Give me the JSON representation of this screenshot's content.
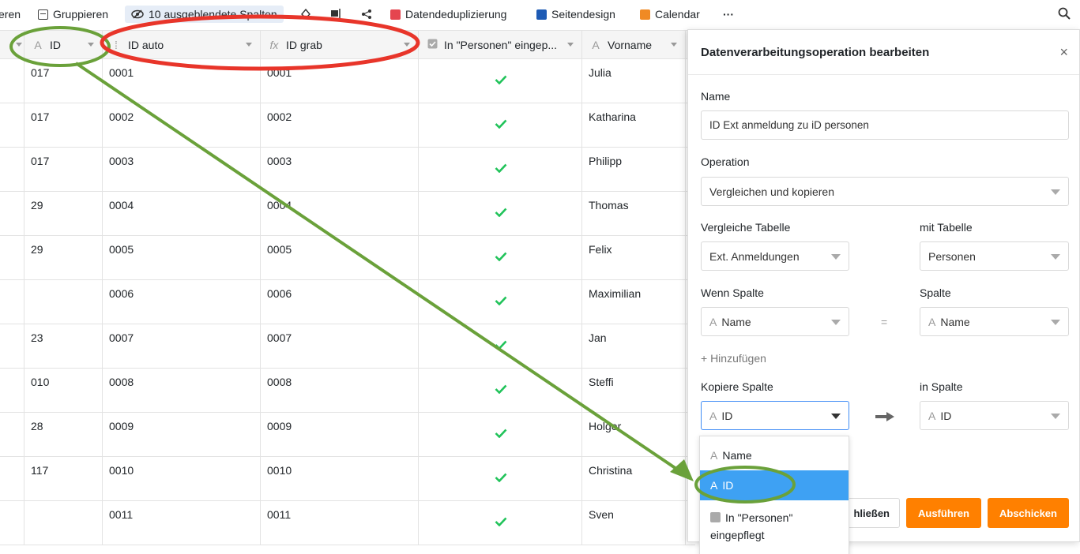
{
  "toolbar": {
    "partial_left": "eren",
    "group": "Gruppieren",
    "hidden_columns": "10 ausgeblendete Spalten",
    "dedup": "Datendeduplizierung",
    "page_design": "Seitendesign",
    "calendar": "Calendar",
    "more": "···",
    "colors": {
      "dedup": "#e5454f",
      "page_design": "#1e5bb5",
      "calendar": "#f08a24"
    }
  },
  "table": {
    "columns": [
      {
        "label": "ID",
        "icon": "text-icon"
      },
      {
        "label": "ID auto",
        "icon": "autonumber-icon"
      },
      {
        "label": "ID grab",
        "icon": "formula-icon"
      },
      {
        "label": "In \"Personen\" eingep...",
        "icon": "checkbox-icon"
      },
      {
        "label": "Vorname",
        "icon": "text-icon"
      }
    ],
    "rows": [
      {
        "id": "017",
        "auto": "0001",
        "grab": "0001",
        "checked": true,
        "vorname": "Julia"
      },
      {
        "id": "017",
        "auto": "0002",
        "grab": "0002",
        "checked": true,
        "vorname": "Katharina"
      },
      {
        "id": "017",
        "auto": "0003",
        "grab": "0003",
        "checked": true,
        "vorname": "Philipp"
      },
      {
        "id": "29",
        "auto": "0004",
        "grab": "0004",
        "checked": true,
        "vorname": "Thomas"
      },
      {
        "id": "29",
        "auto": "0005",
        "grab": "0005",
        "checked": true,
        "vorname": "Felix"
      },
      {
        "id": "",
        "auto": "0006",
        "grab": "0006",
        "checked": true,
        "vorname": "Maximilian"
      },
      {
        "id": "23",
        "auto": "0007",
        "grab": "0007",
        "checked": true,
        "vorname": "Jan"
      },
      {
        "id": "010",
        "auto": "0008",
        "grab": "0008",
        "checked": true,
        "vorname": "Steffi"
      },
      {
        "id": "28",
        "auto": "0009",
        "grab": "0009",
        "checked": true,
        "vorname": "Holger"
      },
      {
        "id": "117",
        "auto": "0010",
        "grab": "0010",
        "checked": true,
        "vorname": "Christina"
      },
      {
        "id": "",
        "auto": "0011",
        "grab": "0011",
        "checked": true,
        "vorname": "Sven"
      }
    ],
    "check_color": "#21c35a"
  },
  "panel": {
    "title": "Datenverarbeitungsoperation bearbeiten",
    "close": "×",
    "name_label": "Name",
    "name_value": "ID Ext anmeldung zu iD personen",
    "operation_label": "Operation",
    "operation_value": "Vergleichen und kopieren",
    "compare_table_label": "Vergleiche Tabelle",
    "compare_table_value": "Ext. Anmeldungen",
    "with_table_label": "mit Tabelle",
    "with_table_value": "Personen",
    "if_column_label": "Wenn Spalte",
    "if_column_value": "Name",
    "equals": "=",
    "column_label": "Spalte",
    "column_value": "Name",
    "add_label": "+ Hinzufügen",
    "copy_column_label": "Kopiere Spalte",
    "copy_column_value": "ID",
    "in_column_label": "in Spalte",
    "in_column_value": "ID",
    "close_button": "hließen",
    "run_button": "Ausführen",
    "submit_button": "Abschicken",
    "accent_color": "#ff8000"
  },
  "dropdown": {
    "options": [
      "Name",
      "ID",
      "In \"Personen\" eingepflegt"
    ],
    "selected": "ID",
    "selected_color": "#3ea1f3"
  },
  "annotations": {
    "green_color": "#6aa13a",
    "red_color": "#e8352a"
  }
}
